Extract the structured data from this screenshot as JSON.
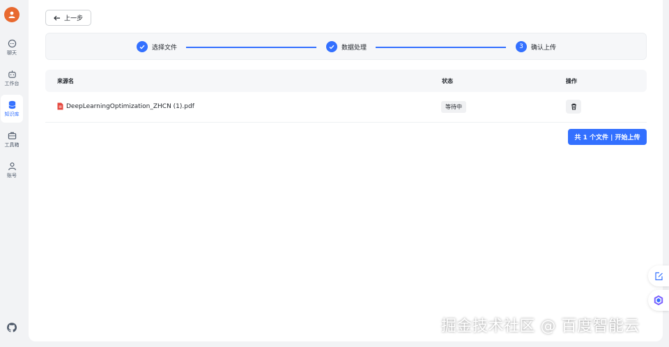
{
  "sidebar": {
    "items": [
      {
        "label": "聊天",
        "icon": "chat-icon"
      },
      {
        "label": "工作台",
        "icon": "robot-icon"
      },
      {
        "label": "知识库",
        "icon": "database-icon",
        "active": true
      },
      {
        "label": "工具箱",
        "icon": "toolbox-icon"
      },
      {
        "label": "账号",
        "icon": "user-icon"
      }
    ]
  },
  "back_button": {
    "label": "上一步"
  },
  "steps": [
    {
      "label": "选择文件",
      "state": "done"
    },
    {
      "label": "数据处理",
      "state": "done"
    },
    {
      "label": "确认上传",
      "state": "current",
      "number": "3"
    }
  ],
  "table": {
    "headers": [
      "来源名",
      "状态",
      "操作"
    ],
    "rows": [
      {
        "file_name": "DeepLearningOptimization_ZHCN (1).pdf",
        "status": "等待中"
      }
    ]
  },
  "upload_button": {
    "label": "共 1 个文件 | 开始上传"
  },
  "watermark": "掘金技术社区 @ 百度智能云",
  "colors": {
    "accent": "#3370ff",
    "avatar": "#e8692f",
    "pdf": "#e5483f"
  }
}
